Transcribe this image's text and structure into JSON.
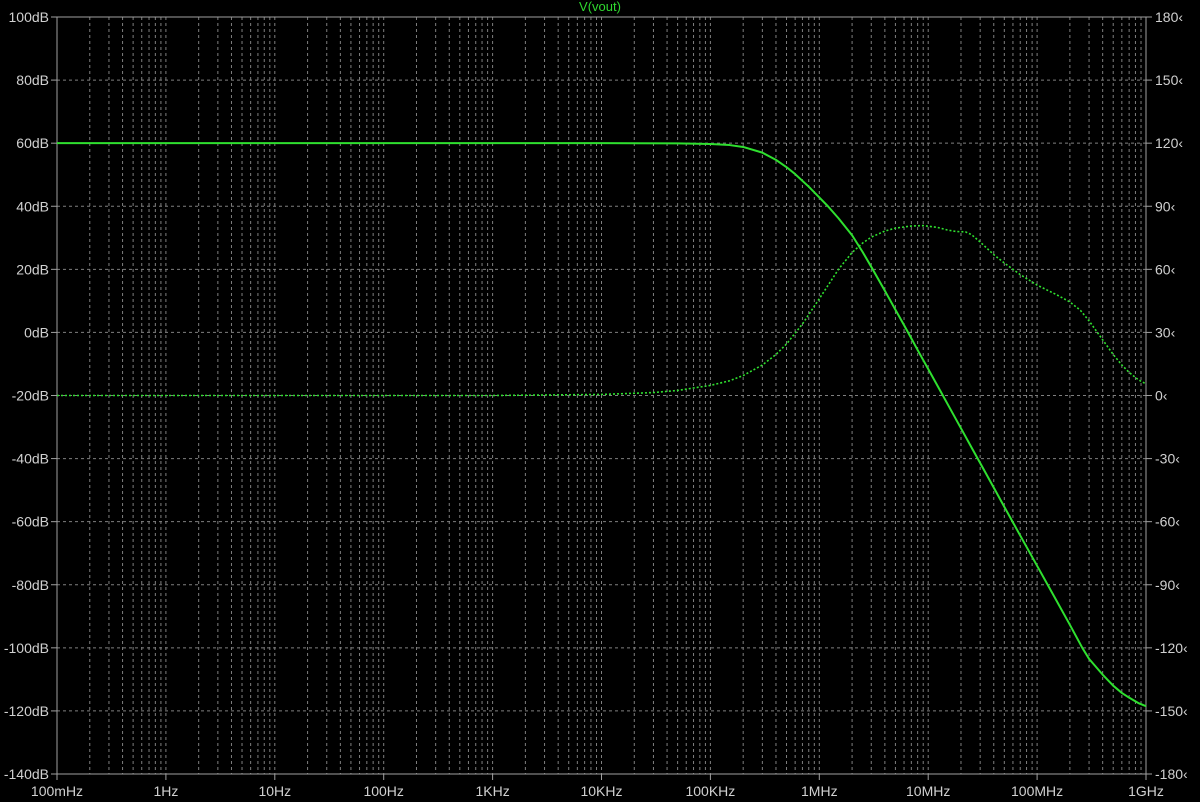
{
  "chart_data": {
    "type": "line",
    "title": "V(vout)",
    "x_scale": "log",
    "xlim": [
      0.1,
      1000000000
    ],
    "x_tick_values": [
      0.1,
      1,
      10,
      100,
      1000,
      10000,
      100000,
      1000000,
      10000000,
      100000000,
      1000000000
    ],
    "x_tick_labels": [
      "100mHz",
      "1Hz",
      "10Hz",
      "100Hz",
      "1KHz",
      "10KHz",
      "100KHz",
      "1MHz",
      "10MHz",
      "100MHz",
      "1GHz"
    ],
    "y_left": {
      "ylim": [
        -140,
        100
      ],
      "tick_values": [
        100,
        80,
        60,
        40,
        20,
        0,
        -20,
        -40,
        -60,
        -80,
        -100,
        -120,
        -140
      ],
      "tick_labels": [
        "100dB",
        "80dB",
        "60dB",
        "40dB",
        "20dB",
        "0dB",
        "-20dB",
        "-40dB",
        "-60dB",
        "-80dB",
        "-100dB",
        "-120dB",
        "-140dB"
      ]
    },
    "y_right": {
      "ylim": [
        -180,
        180
      ],
      "tick_values": [
        180,
        150,
        120,
        90,
        60,
        30,
        0,
        -30,
        -60,
        -90,
        -120,
        -150,
        -180
      ],
      "tick_labels": [
        "180‹",
        "150‹",
        "120‹",
        "90‹",
        "60‹",
        "30‹",
        "0‹",
        "-30‹",
        "-60‹",
        "-90‹",
        "-120‹",
        "-150‹",
        "-180‹"
      ]
    },
    "grid": true,
    "series": [
      {
        "axis": "left",
        "line_style": "solid",
        "points": [
          [
            0.1,
            60
          ],
          [
            1000,
            60
          ],
          [
            10000,
            60
          ],
          [
            50000,
            59.95
          ],
          [
            100000,
            59.75
          ],
          [
            150000,
            59.4
          ],
          [
            200000,
            58.8
          ],
          [
            300000,
            57
          ],
          [
            400000,
            54.7
          ],
          [
            500000,
            52.4
          ],
          [
            600000,
            50.2
          ],
          [
            800000,
            46.2
          ],
          [
            1000000,
            42.8
          ],
          [
            1200000,
            40
          ],
          [
            1500000,
            36.2
          ],
          [
            2000000,
            30.8
          ],
          [
            2500000,
            25.5
          ],
          [
            3000000,
            20.8
          ],
          [
            4000000,
            13.2
          ],
          [
            5000000,
            7.2
          ],
          [
            6000000,
            2.3
          ],
          [
            7000000,
            -1.9
          ],
          [
            8000000,
            -5.6
          ],
          [
            10000000,
            -11.6
          ],
          [
            13000000,
            -18.7
          ],
          [
            15000000,
            -22.6
          ],
          [
            20000000,
            -30.4
          ],
          [
            25000000,
            -36.5
          ],
          [
            30000000,
            -41.4
          ],
          [
            40000000,
            -49.2
          ],
          [
            50000000,
            -55.3
          ],
          [
            70000000,
            -64.4
          ],
          [
            100000000,
            -74
          ],
          [
            150000000,
            -84.9
          ],
          [
            200000000,
            -92.7
          ],
          [
            260000000,
            -100
          ],
          [
            300000000,
            -103.5
          ],
          [
            400000000,
            -108.5
          ],
          [
            500000000,
            -112
          ],
          [
            600000000,
            -114.3
          ],
          [
            700000000,
            -115.8
          ],
          [
            850000000,
            -117.5
          ],
          [
            1000000000,
            -118.5
          ]
        ]
      },
      {
        "axis": "right",
        "line_style": "dotted",
        "points": [
          [
            0.1,
            0
          ],
          [
            1000,
            0
          ],
          [
            10000,
            0.5
          ],
          [
            30000,
            1.4
          ],
          [
            50000,
            2.4
          ],
          [
            100000,
            4.8
          ],
          [
            150000,
            7
          ],
          [
            200000,
            9.5
          ],
          [
            300000,
            14.5
          ],
          [
            400000,
            19.5
          ],
          [
            500000,
            24.5
          ],
          [
            700000,
            34
          ],
          [
            1000000,
            46
          ],
          [
            1500000,
            60
          ],
          [
            2000000,
            68
          ],
          [
            2500000,
            72.5
          ],
          [
            3000000,
            75.3
          ],
          [
            4000000,
            78.2
          ],
          [
            5000000,
            79.6
          ],
          [
            7000000,
            80.6
          ],
          [
            9000000,
            80.8
          ],
          [
            12000000,
            80
          ],
          [
            15000000,
            78.7
          ],
          [
            18000000,
            78
          ],
          [
            22000000,
            77.8
          ],
          [
            25000000,
            76.5
          ],
          [
            30000000,
            73
          ],
          [
            40000000,
            67
          ],
          [
            50000000,
            63
          ],
          [
            70000000,
            57.5
          ],
          [
            100000000,
            52.5
          ],
          [
            150000000,
            48
          ],
          [
            200000000,
            44.5
          ],
          [
            250000000,
            40.5
          ],
          [
            300000000,
            35.5
          ],
          [
            400000000,
            26.5
          ],
          [
            500000000,
            19.5
          ],
          [
            600000000,
            14.5
          ],
          [
            700000000,
            11
          ],
          [
            850000000,
            7.5
          ],
          [
            1000000000,
            5.5
          ]
        ]
      }
    ]
  },
  "colors": {
    "background": "#000000",
    "grid": "#7f7f7f",
    "frame": "#a0a0a0",
    "tick_text": "#d0d0d0",
    "trace": "#2fe02f",
    "title": "#2fd82f"
  }
}
